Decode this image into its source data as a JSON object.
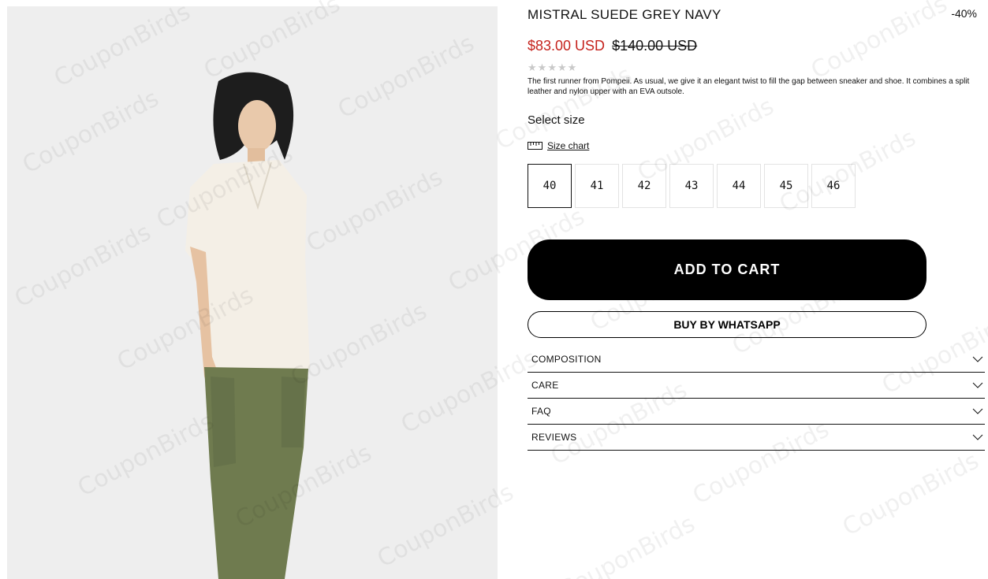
{
  "product": {
    "title": "MISTRAL SUEDE GREY NAVY",
    "discount": "-40%",
    "price_sale": "$83.00 USD",
    "price_old": "$140.00 USD",
    "description": "The first runner from Pompeii. As usual, we give it an elegant twist to fill the gap between sneaker and shoe. It combines a split leather and nylon upper with an EVA outsole."
  },
  "size_selector": {
    "label": "Select size",
    "chart_label": "Size chart",
    "sizes": [
      "40",
      "41",
      "42",
      "43",
      "44",
      "45",
      "46"
    ],
    "selected": "40"
  },
  "actions": {
    "add_to_cart": "ADD TO CART",
    "whatsapp": "BUY BY WHATSAPP"
  },
  "accordion": [
    "COMPOSITION",
    "CARE",
    "FAQ",
    "REVIEWS"
  ],
  "watermark": "CouponBirds",
  "colors": {
    "sale": "#c5231d",
    "button": "#000000",
    "image_bg": "#efefef"
  }
}
